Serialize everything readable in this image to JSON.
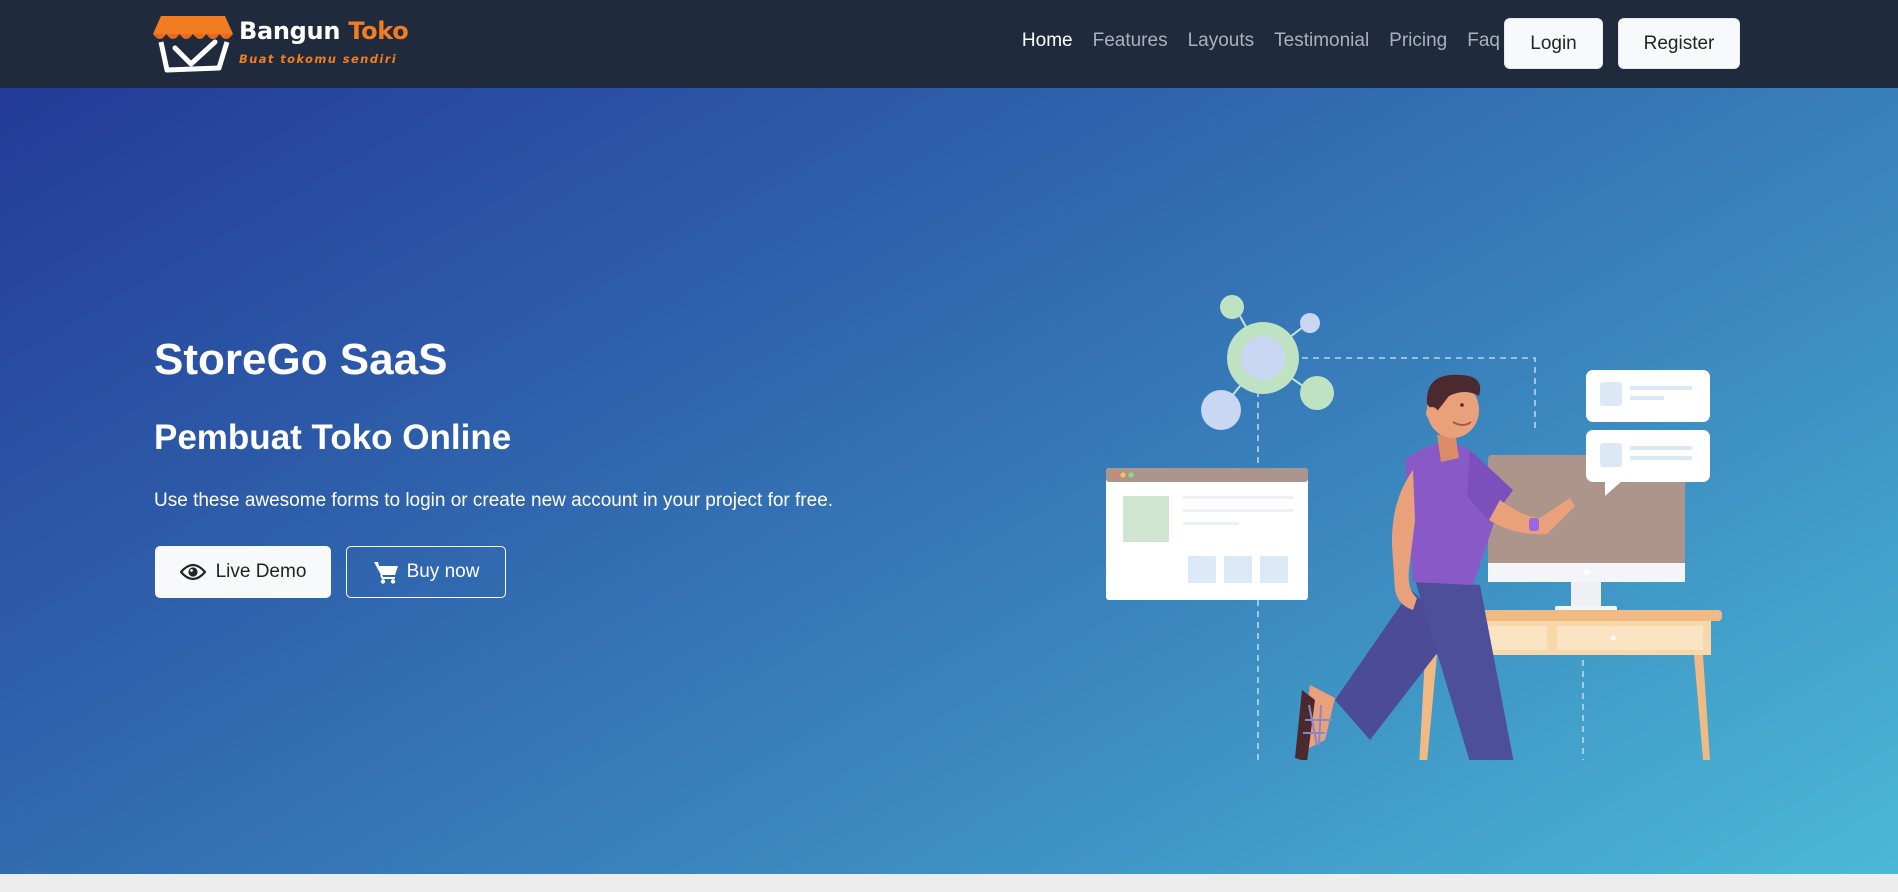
{
  "brand": {
    "name_main": "Bangun ",
    "name_accent": "Toko",
    "tagline": "Buat tokomu sendiri",
    "logo_icon": "shop-awning-logo",
    "colors": {
      "accent": "#f27c21",
      "navbar": "#1f2a3c"
    }
  },
  "nav": {
    "links": [
      {
        "label": "Home",
        "active": true
      },
      {
        "label": "Features"
      },
      {
        "label": "Layouts"
      },
      {
        "label": "Testimonial"
      },
      {
        "label": "Pricing"
      },
      {
        "label": "Faq"
      }
    ],
    "login_label": "Login",
    "register_label": "Register"
  },
  "hero": {
    "title": "StoreGo SaaS",
    "subtitle": "Pembuat Toko Online",
    "description": "Use these awesome forms to login or create new account in your project for free.",
    "demo_button": {
      "label": "Live Demo",
      "icon": "eye-icon"
    },
    "buy_button": {
      "label": "Buy now",
      "icon": "cart-icon"
    },
    "gradient": [
      "#233b97",
      "#4bb9d6"
    ],
    "illustration": "man-running-to-desk-illustration"
  }
}
